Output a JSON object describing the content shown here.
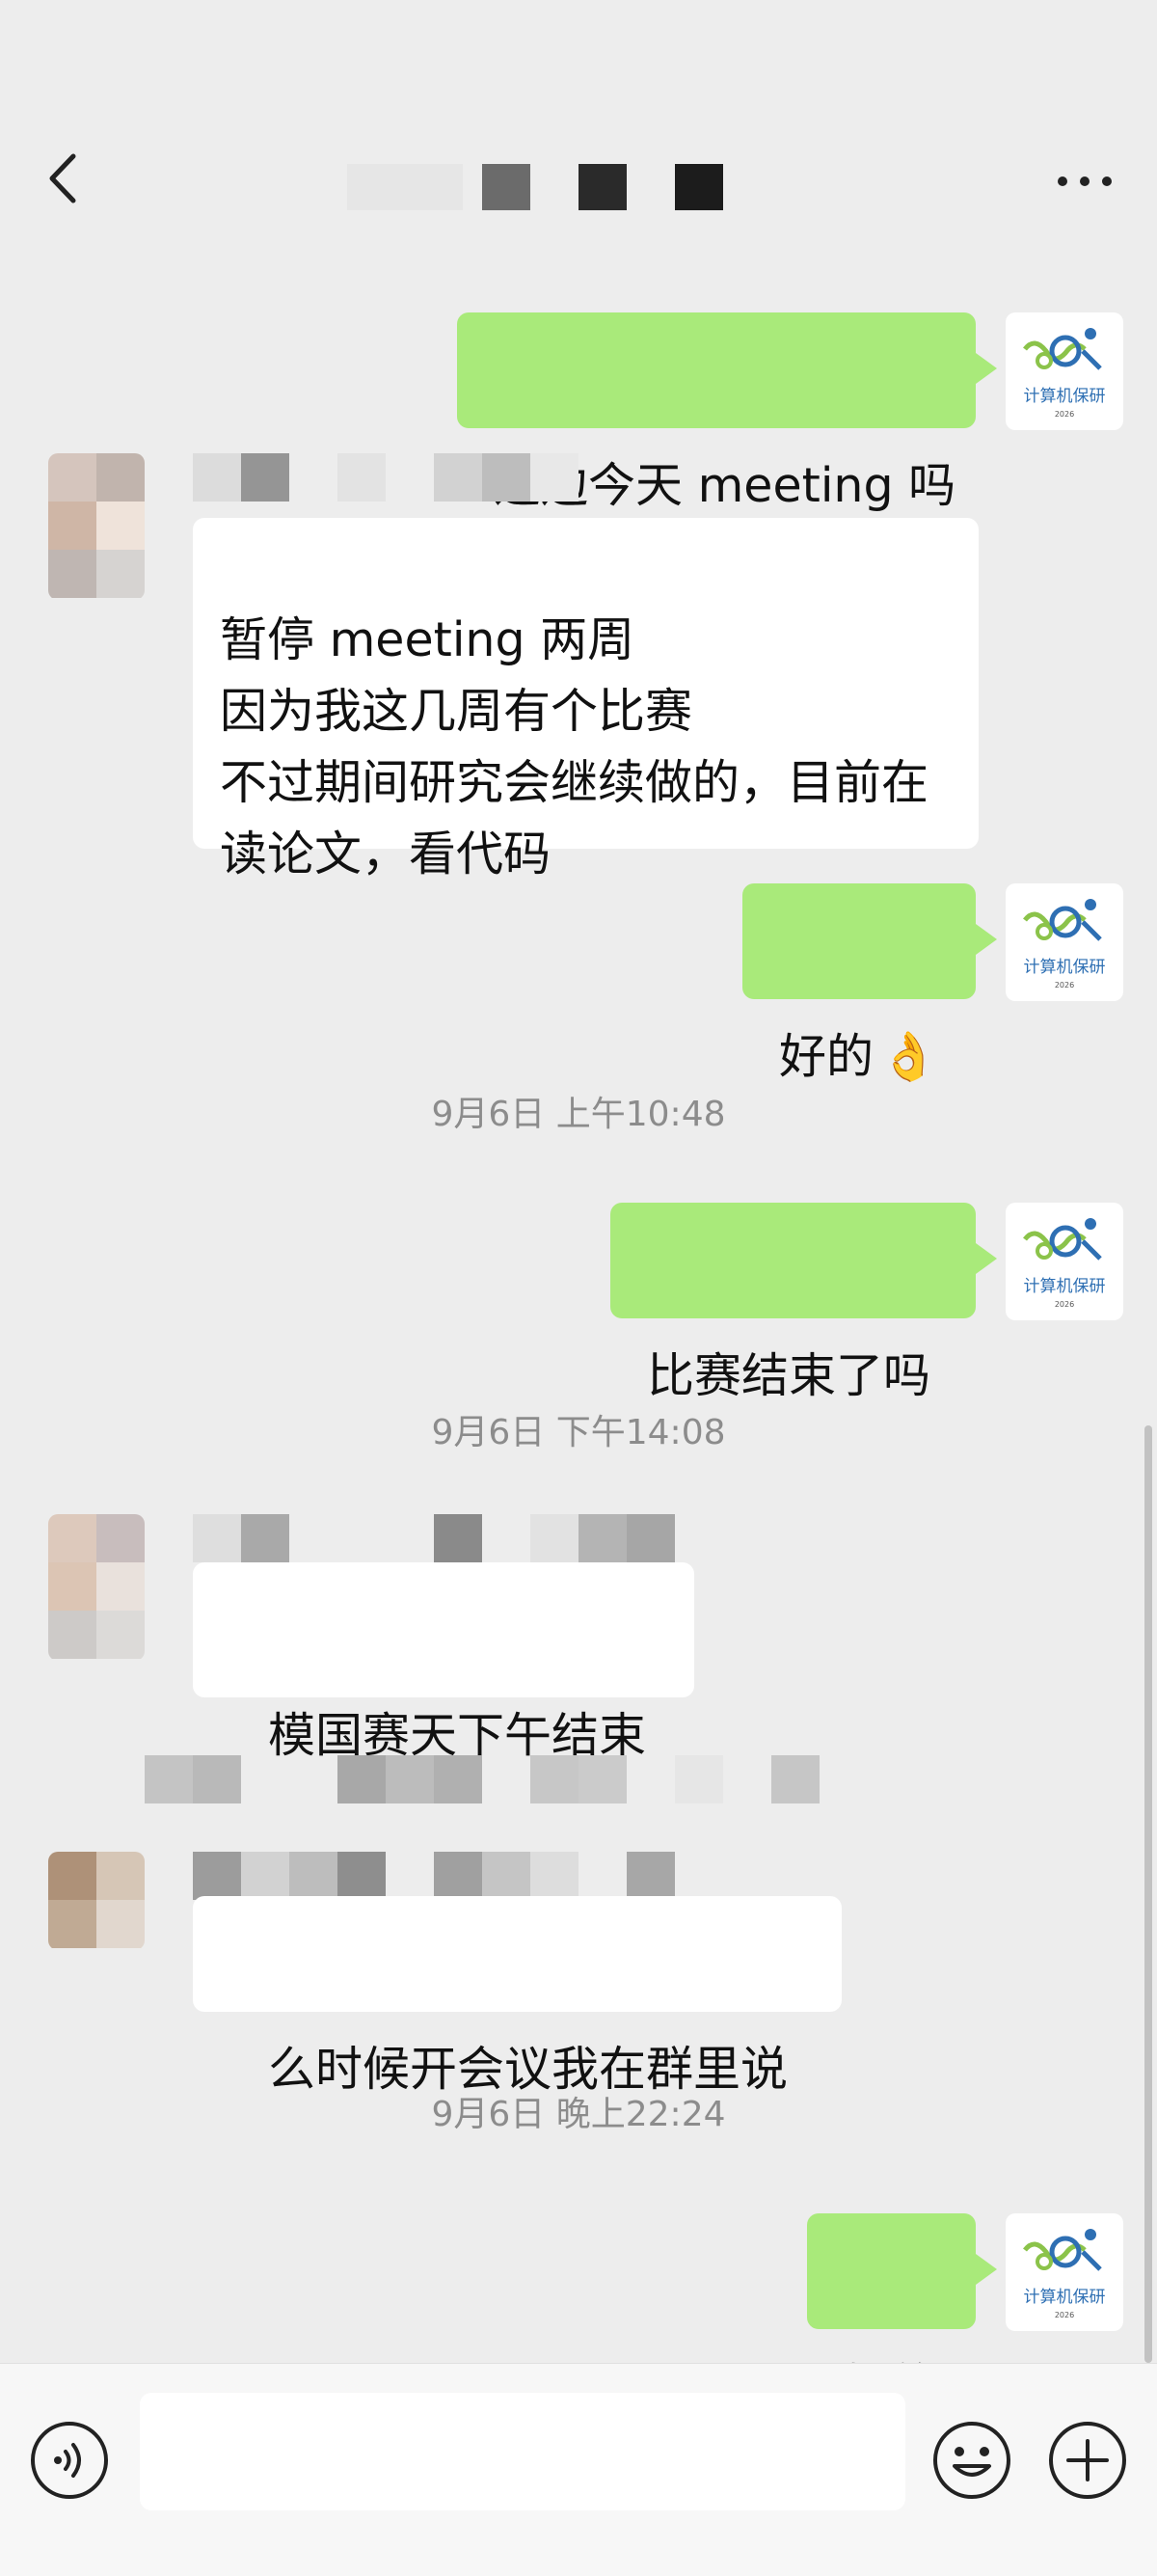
{
  "header": {
    "title_text": "",
    "colors": {
      "background": "#ededed"
    }
  },
  "logo": {
    "text": "计算机保研",
    "subtext": "2026"
  },
  "messages": [
    {
      "side": "right",
      "text": "这边今天 meeting 吗"
    },
    {
      "side": "left",
      "text": "暂停 meeting 两周\n因为我这几周有个比赛\n不过期间研究会继续做的，目前在\n读论文，看代码"
    },
    {
      "side": "right",
      "text": "好的",
      "emoji": "👌"
    },
    {
      "side": "time",
      "text": "9月6日 上午10:48"
    },
    {
      "side": "right",
      "text": "比赛结束了吗"
    },
    {
      "side": "time",
      "text": "9月6日 下午14:08"
    },
    {
      "side": "left",
      "text": "模国赛天下午结束"
    },
    {
      "side": "left",
      "text": "么时候开会议我在群里说"
    },
    {
      "side": "time",
      "text": "9月6日 晚上22:24"
    },
    {
      "side": "right",
      "text": "好的"
    }
  ],
  "input": {
    "placeholder": ""
  },
  "icons": {
    "back": "chevron-left-icon",
    "more": "more-dots-icon",
    "voice": "voice-icon",
    "emoji": "emoji-icon",
    "plus": "plus-icon"
  },
  "colors": {
    "green_bubble": "#a9ea7a",
    "white_bubble": "#ffffff",
    "timestamp": "#8c8c8c",
    "logo_blue": "#2e6fb3",
    "logo_green": "#8bc34a"
  }
}
